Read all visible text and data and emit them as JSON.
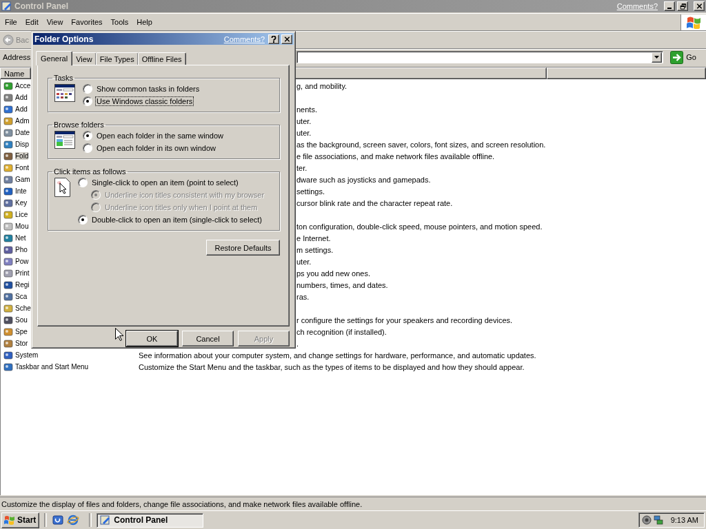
{
  "window": {
    "title": "Control Panel",
    "comments_link": "Comments?"
  },
  "menu": [
    "File",
    "Edit",
    "View",
    "Favorites",
    "Tools",
    "Help"
  ],
  "toolbar": {
    "back": "Bac"
  },
  "address": {
    "label": "Address",
    "go": "Go"
  },
  "columns": [
    "Name"
  ],
  "items": [
    {
      "name": "Acce",
      "description": "g, and mobility.",
      "selected": false
    },
    {
      "name": "Add",
      "selected": false
    },
    {
      "name": "Add",
      "description": "nents.",
      "selected": false
    },
    {
      "name": "Adm",
      "description": "uter.",
      "selected": false
    },
    {
      "name": "Date",
      "description": "uter.",
      "selected": false
    },
    {
      "name": "Disp",
      "description": "as the background, screen saver, colors, font sizes, and screen resolution.",
      "selected": false
    },
    {
      "name": "Fold",
      "description": "e file associations, and make network files available offline.",
      "selected": true
    },
    {
      "name": "Font",
      "description": "ter.",
      "selected": false
    },
    {
      "name": "Gam",
      "description": "dware such as joysticks and gamepads.",
      "selected": false
    },
    {
      "name": "Inte",
      "description": "settings.",
      "selected": false
    },
    {
      "name": "Key",
      "description": "cursor blink rate and the character repeat rate.",
      "selected": false
    },
    {
      "name": "Lice",
      "selected": false
    },
    {
      "name": "Mou",
      "description": "ton configuration, double-click speed, mouse pointers, and motion speed.",
      "selected": false
    },
    {
      "name": "Net",
      "description": "e Internet.",
      "selected": false
    },
    {
      "name": "Pho",
      "description": "m settings.",
      "selected": false
    },
    {
      "name": "Pow",
      "description": "uter.",
      "selected": false
    },
    {
      "name": "Print",
      "description": "ps you add new ones.",
      "selected": false
    },
    {
      "name": "Regi",
      "description": "numbers, times, and dates.",
      "selected": false
    },
    {
      "name": "Sca",
      "description": "ras.",
      "selected": false
    },
    {
      "name": "Sche",
      "selected": false
    },
    {
      "name": "Sou",
      "description": "r configure the settings for your speakers and recording devices.",
      "selected": false
    },
    {
      "name": "Spe",
      "description": "ch recognition (if installed).",
      "selected": false
    },
    {
      "name": "Stor",
      "description": ".",
      "selected": false
    },
    {
      "name": "System",
      "description": "See information about your computer system, and change settings for hardware, performance, and automatic updates.",
      "selected": false
    },
    {
      "name": "Taskbar and Start Menu",
      "description": "Customize the Start Menu and the taskbar, such as the types of items to be displayed and how they should appear.",
      "selected": false
    }
  ],
  "status_bar": "Customize the display of files and folders, change file associations, and make network files available offline.",
  "dialog": {
    "title": "Folder Options",
    "comments_link": "Comments?",
    "tabs": [
      {
        "label": "General",
        "selected": true
      },
      {
        "label": "View",
        "selected": false
      },
      {
        "label": "File Types",
        "selected": false
      },
      {
        "label": "Offline Files",
        "selected": false
      }
    ],
    "groups": [
      {
        "title": "Tasks",
        "kind": "tasks",
        "options": [
          {
            "label": "Show common tasks in folders",
            "selected": false,
            "disabled": false,
            "focused": false
          },
          {
            "label": "Use Windows classic folders",
            "selected": true,
            "disabled": false,
            "focused": true
          }
        ]
      },
      {
        "title": "Browse folders",
        "kind": "browse",
        "options": [
          {
            "label": "Open each folder in the same window",
            "selected": true,
            "disabled": false,
            "focused": false
          },
          {
            "label": "Open each folder in its own window",
            "selected": false,
            "disabled": false,
            "focused": false
          }
        ]
      },
      {
        "title": "Click items as follows",
        "kind": "click",
        "options": [
          {
            "label": "Single-click to open an item (point to select)",
            "selected": false,
            "disabled": false,
            "focused": false,
            "children": [
              {
                "label": "Underline icon titles consistent with my browser",
                "selected": true,
                "disabled": true,
                "focused": false
              },
              {
                "label": "Underline icon titles only when I point at them",
                "selected": false,
                "disabled": true,
                "focused": false
              }
            ]
          },
          {
            "label": "Double-click to open an item (single-click to select)",
            "selected": true,
            "disabled": false,
            "focused": false
          }
        ]
      }
    ],
    "restore_button": "Restore Defaults",
    "buttons": [
      {
        "label": "OK",
        "default": true,
        "disabled": false
      },
      {
        "label": "Cancel",
        "default": false,
        "disabled": false
      },
      {
        "label": "Apply",
        "default": false,
        "disabled": true
      }
    ]
  },
  "taskbar": {
    "start": "Start",
    "tasks": [
      {
        "label": "Control Panel",
        "selected": true
      }
    ],
    "clock": "9:13 AM"
  }
}
